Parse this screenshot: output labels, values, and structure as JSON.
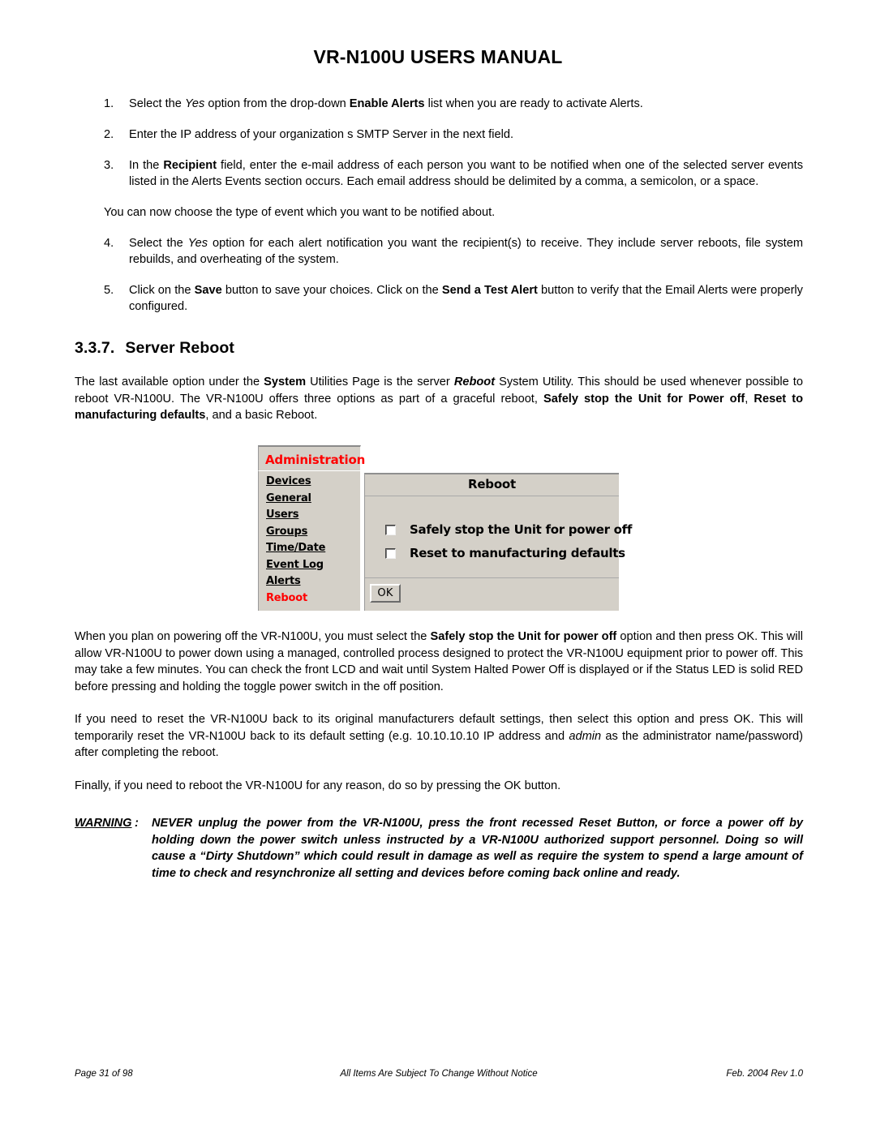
{
  "header": {
    "title": "VR-N100U USERS MANUAL"
  },
  "steps": [
    {
      "number": "1.",
      "parts": [
        {
          "text": "Select the ",
          "style": "normal"
        },
        {
          "text": "Yes",
          "style": "italic"
        },
        {
          "text": " option from the drop-down ",
          "style": "normal"
        },
        {
          "text": "Enable Alerts",
          "style": "bold"
        },
        {
          "text": " list when you are ready to activate Alerts.",
          "style": "normal"
        }
      ]
    },
    {
      "number": "2.",
      "parts": [
        {
          "text": "Enter the IP address of your organization s SMTP Server in the next field.",
          "style": "normal"
        }
      ]
    },
    {
      "number": "3.",
      "parts": [
        {
          "text": "In the ",
          "style": "normal"
        },
        {
          "text": "Recipient",
          "style": "bold"
        },
        {
          "text": " field, enter the e-mail address of each person you want to be notified when one of the selected server events listed in the Alerts Events section occurs. Each email address should be delimited by a comma, a semicolon, or a space.",
          "style": "normal"
        }
      ]
    }
  ],
  "interlude": "You can now choose the type of event which you want to be notified about.",
  "steps2": [
    {
      "number": "4.",
      "parts": [
        {
          "text": "Select the ",
          "style": "normal"
        },
        {
          "text": "Yes",
          "style": "italic"
        },
        {
          "text": " option for each alert notification you want the recipient(s) to receive. They include server reboots, file system rebuilds, and overheating of the system.",
          "style": "normal"
        }
      ]
    },
    {
      "number": "5.",
      "parts": [
        {
          "text": "Click on the ",
          "style": "normal"
        },
        {
          "text": "Save",
          "style": "bold"
        },
        {
          "text": " button to save your choices. Click on the ",
          "style": "normal"
        },
        {
          "text": "Send a Test Alert",
          "style": "bold"
        },
        {
          "text": " button to verify that the Email Alerts were properly configured.",
          "style": "normal"
        }
      ]
    }
  ],
  "section": {
    "number": "3.3.7.",
    "title": "Server Reboot",
    "intro_parts": [
      {
        "text": "The last available option under the ",
        "style": "normal"
      },
      {
        "text": "System",
        "style": "bold"
      },
      {
        "text": " Utilities Page is the server ",
        "style": "normal"
      },
      {
        "text": "Reboot",
        "style": "bolditalic"
      },
      {
        "text": " System Utility. This should be used whenever possible to reboot VR-N100U. The VR-N100U offers three options as part of a graceful reboot, ",
        "style": "normal"
      },
      {
        "text": "Safely stop the Unit for Power off",
        "style": "bold"
      },
      {
        "text": ", ",
        "style": "normal"
      },
      {
        "text": "Reset to manufacturing defaults",
        "style": "bold"
      },
      {
        "text": ", and a basic Reboot.",
        "style": "normal"
      }
    ]
  },
  "screenshot": {
    "sidebar": {
      "header": "Administration",
      "header_color": "#ff0000",
      "items": [
        {
          "label": "Devices",
          "current": false
        },
        {
          "label": "General",
          "current": false
        },
        {
          "label": "Users",
          "current": false
        },
        {
          "label": "Groups",
          "current": false
        },
        {
          "label": "Time/Date",
          "current": false
        },
        {
          "label": "Event Log",
          "current": false
        },
        {
          "label": "Alerts",
          "current": false
        },
        {
          "label": "Reboot",
          "current": true
        }
      ],
      "current_color": "#ff0000"
    },
    "panel": {
      "title": "Reboot",
      "options": [
        {
          "label": "Safely stop the Unit for power off",
          "checked": false
        },
        {
          "label": "Reset to manufacturing defaults",
          "checked": false
        }
      ],
      "ok_label": "OK"
    }
  },
  "body": {
    "para1_parts": [
      {
        "text": "When you plan on powering off the VR-N100U, you must select the ",
        "style": "normal"
      },
      {
        "text": "Safely stop the Unit for power off",
        "style": "bold"
      },
      {
        "text": " option and then press OK. This will allow VR-N100U to power down using a managed, controlled process designed to protect the VR-N100U equipment prior to power off. This may take a few minutes. You can check the front LCD and wait until  System Halted Power Off  is displayed or if the Status LED is solid RED before pressing and holding the toggle power switch in the off position.",
        "style": "normal"
      }
    ],
    "para2_parts": [
      {
        "text": "If you need to reset the VR-N100U back to its original manufacturers default settings, then select this option and press OK. This will temporarily reset the VR-N100U back to its default setting (e.g. 10.10.10.10 IP address and ",
        "style": "normal"
      },
      {
        "text": "admin",
        "style": "italic"
      },
      {
        "text": " as the administrator name/password) after completing the reboot.",
        "style": "normal"
      }
    ],
    "para3": "Finally, if you need to reboot the VR-N100U for any reason, do so by pressing the OK button."
  },
  "warning": {
    "label": "WARNING",
    "colon": ":",
    "text": "NEVER unplug the power from the VR-N100U, press the front recessed Reset Button, or force a power off by holding down the power switch unless instructed by a VR-N100U authorized support personnel. Doing so will cause a “Dirty Shutdown” which could result in damage as well as require the system to spend a large amount of time to check and resynchronize all setting and devices before coming back online and ready."
  },
  "footer": {
    "left": "Page 31 of 98",
    "center": "All Items Are Subject To Change Without Notice",
    "right": "Feb. 2004 Rev 1.0"
  }
}
